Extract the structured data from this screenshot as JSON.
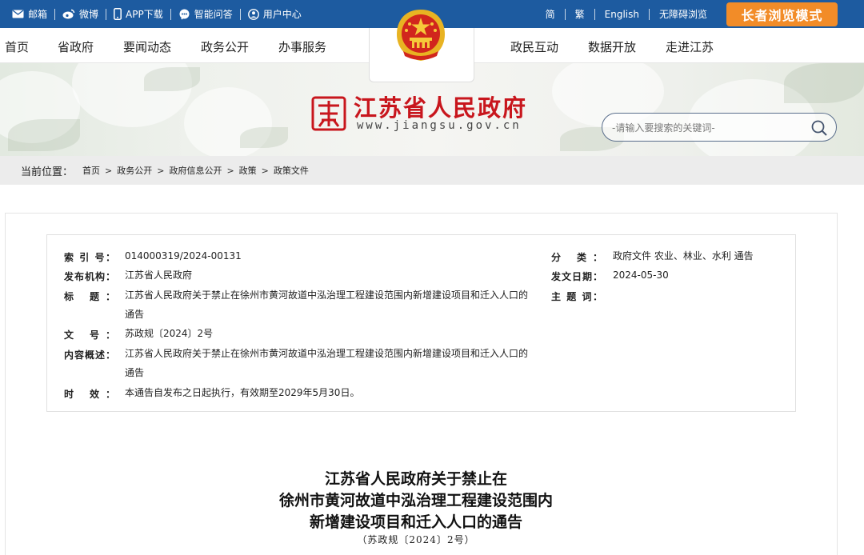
{
  "topbar": {
    "links": [
      {
        "label": "邮箱",
        "icon": "mail-icon"
      },
      {
        "label": "微博",
        "icon": "weibo-icon"
      },
      {
        "label": "APP下载",
        "icon": "phone-icon"
      },
      {
        "label": "智能问答",
        "icon": "chat-icon"
      },
      {
        "label": "用户中心",
        "icon": "user-icon"
      }
    ],
    "right": [
      "简",
      "繁",
      "English",
      "无障碍浏览"
    ],
    "elder_mode": "长者浏览模式"
  },
  "nav": {
    "left": [
      "首页",
      "省政府",
      "要闻动态",
      "政务公开",
      "办事服务"
    ],
    "right": [
      "政民互动",
      "数据开放",
      "走进江苏"
    ]
  },
  "banner": {
    "title": "江苏省人民政府",
    "url": "www.jiangsu.gov.cn",
    "search_placeholder": "-请输入要搜索的关键词-"
  },
  "breadcrumb": {
    "label": "当前位置：",
    "items": [
      "首页",
      "政务公开",
      "政府信息公开",
      "政策",
      "政策文件"
    ],
    "separator": ">"
  },
  "meta": {
    "index_label": "索 引 号：",
    "index_value": "014000319/2024-00131",
    "org_label": "发布机构：",
    "org_value": "江苏省人民政府",
    "title_label": "标 题：",
    "title_value": "江苏省人民政府关于禁止在徐州市黄河故道中泓治理工程建设范围内新增建设项目和迁入人口的通告",
    "docno_label": "文 号：",
    "docno_value": "苏政规〔2024〕2号",
    "summary_label": "内容概述：",
    "summary_value": "江苏省人民政府关于禁止在徐州市黄河故道中泓治理工程建设范围内新增建设项目和迁入人口的通告",
    "validity_label": "时 效：",
    "validity_value": "本通告自发布之日起执行，有效期至2029年5月30日。",
    "category_label": "分 类：",
    "category_value": "政府文件 农业、林业、水利 通告",
    "date_label": "发文日期：",
    "date_value": "2024-05-30",
    "subject_label": "主 题 词：",
    "subject_value": ""
  },
  "document": {
    "title_lines": [
      "江苏省人民政府关于禁止在",
      "徐州市黄河故道中泓治理工程建设范围内",
      "新增建设项目和迁入人口的通告"
    ],
    "number": "（苏政规〔2024〕2号）"
  },
  "colors": {
    "topbar": "#1d5ba0",
    "elder_button": "#f28c28",
    "brand_red": "#c8161d"
  }
}
